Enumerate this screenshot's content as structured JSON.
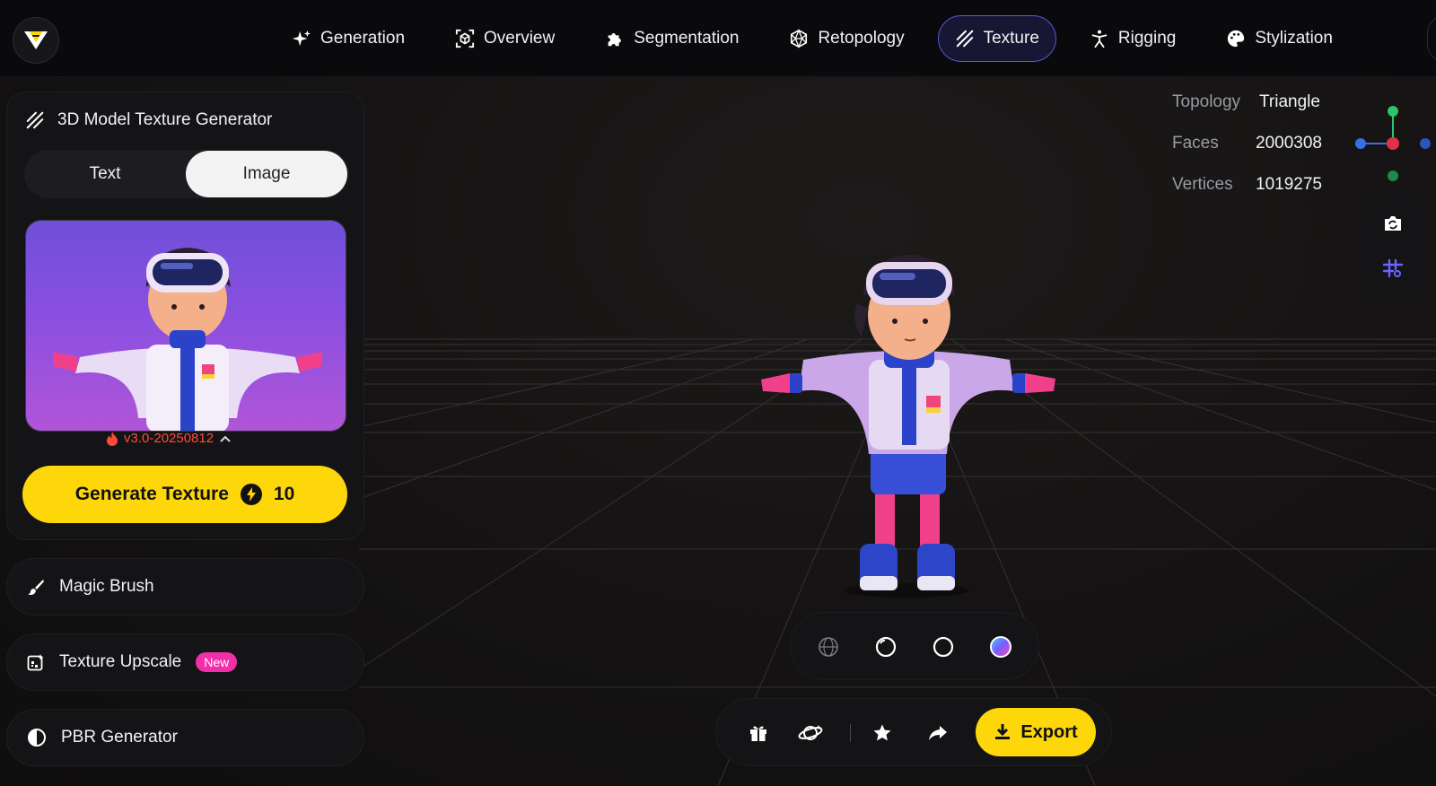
{
  "nav": {
    "items": [
      {
        "label": "Generation",
        "icon": "sparkle-icon",
        "active": false
      },
      {
        "label": "Overview",
        "icon": "cube-scan-icon",
        "active": false
      },
      {
        "label": "Segmentation",
        "icon": "puzzle-icon",
        "active": false
      },
      {
        "label": "Retopology",
        "icon": "polyhedron-icon",
        "active": false
      },
      {
        "label": "Texture",
        "icon": "hatch-icon",
        "active": true
      },
      {
        "label": "Rigging",
        "icon": "figure-icon",
        "active": false
      },
      {
        "label": "Stylization",
        "icon": "palette-icon",
        "active": false
      }
    ]
  },
  "panel": {
    "title": "3D Model Texture Generator",
    "tabs": {
      "text": "Text",
      "image": "Image"
    },
    "selected_tab": "Image",
    "version": "v3.0-20250812",
    "generate_label": "Generate Texture",
    "generate_cost": "10"
  },
  "side_cards": {
    "magic_brush": "Magic Brush",
    "upscale": "Texture Upscale",
    "upscale_badge": "New",
    "pbr": "PBR Generator"
  },
  "model_info": {
    "topology_label": "Topology",
    "topology_value": "Triangle",
    "faces_label": "Faces",
    "faces_value": "2000308",
    "vertices_label": "Vertices",
    "vertices_value": "1019275"
  },
  "actions": {
    "export_label": "Export"
  },
  "colors": {
    "accent_yellow": "#fdd70a",
    "active_nav_border": "#5a55d6",
    "badge_pink": "#f22ea9",
    "version_red": "#ff4a3a"
  }
}
